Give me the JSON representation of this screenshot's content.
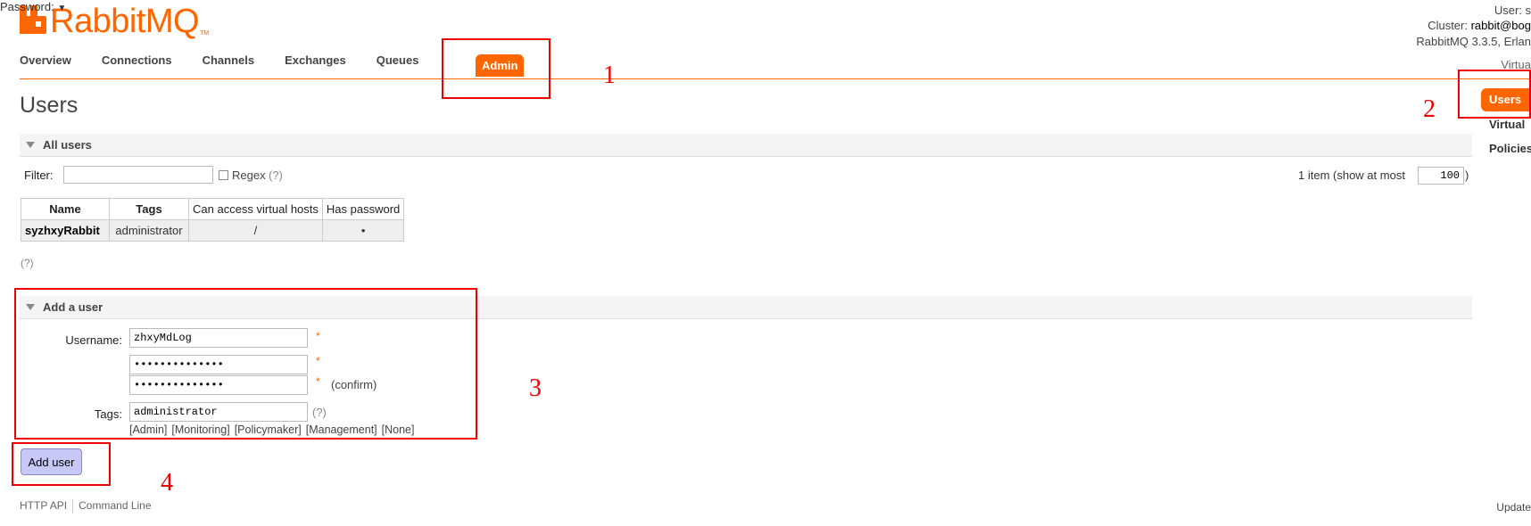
{
  "app": {
    "logo_text": "RabbitMQ",
    "logo_tm": "TM",
    "brand_color": "#ff6600"
  },
  "header_info": {
    "user_label": "User: s",
    "cluster_label": "Cluster: ",
    "cluster_value": "rabbit@bog",
    "version_text": "RabbitMQ 3.3.5, Erlan"
  },
  "nav": {
    "tabs": [
      "Overview",
      "Connections",
      "Channels",
      "Exchanges",
      "Queues"
    ],
    "active_tab": "Admin",
    "virtual_host_label": "Virtua"
  },
  "sidebar": {
    "active": "Users",
    "items": [
      "Virtual",
      "Policies"
    ]
  },
  "page": {
    "title": "Users"
  },
  "all_users": {
    "section_title": "All users",
    "filter_label": "Filter:",
    "filter_value": "",
    "regex_label": "Regex",
    "regex_help": "(?)",
    "count_text": "1 item (show at most",
    "page_size": "100",
    "count_close": ")",
    "columns": [
      "Name",
      "Tags",
      "Can access virtual hosts",
      "Has password"
    ],
    "rows": [
      {
        "name": "syzhxyRabbit",
        "tags": "administrator",
        "vhosts": "/",
        "has_password": "•"
      }
    ],
    "table_help": "(?)"
  },
  "add_user": {
    "section_title": "Add a user",
    "username_label": "Username:",
    "username_value": "zhxyMdLog",
    "password_mode": "Password:",
    "password_value": "••••••••••••••",
    "confirm_value": "••••••••••••••",
    "confirm_label": "(confirm)",
    "required_mark": "*",
    "tags_label": "Tags:",
    "tags_value": "administrator",
    "tags_help": "(?)",
    "tag_options": [
      "[Admin]",
      "[Monitoring]",
      "[Policymaker]",
      "[Management]",
      "[None]"
    ],
    "submit_label": "Add user"
  },
  "annotations": [
    "1",
    "2",
    "3",
    "4"
  ],
  "footer": {
    "links": [
      "HTTP API",
      "Command Line"
    ],
    "right_text": "Update"
  }
}
